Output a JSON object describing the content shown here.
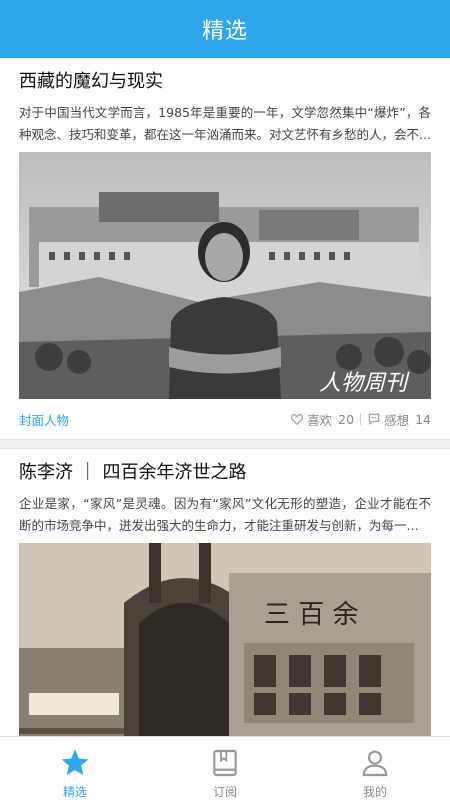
{
  "header": {
    "title": "精选"
  },
  "cards": [
    {
      "title": "西藏的魔幻与现实",
      "summary": "对于中国当代文学而言，1985年是重要的一年，文学忽然集中“爆炸”，各种观念、技巧和变革，都在这一年汹涌而来。对文艺怀有乡愁的人，会不...",
      "image_watermark": "人物周刊",
      "category": "封面人物",
      "likes_label": "喜欢",
      "likes_count": "20",
      "comments_label": "感想",
      "comments_count": "14"
    },
    {
      "title": "陈李济 ｜ 四百余年济世之路",
      "summary": "企业是家，“家风”是灵魂。因为有“家风”文化无形的塑造，企业才能在不断的市场竞争中，迸发出强大的生命力，才能注重研发与创新，为每一...",
      "image_sign": "三 百 余"
    }
  ],
  "tabbar": {
    "items": [
      {
        "label": "精选",
        "icon": "star-icon",
        "active": true
      },
      {
        "label": "订阅",
        "icon": "book-icon",
        "active": false
      },
      {
        "label": "我的",
        "icon": "user-icon",
        "active": false
      }
    ]
  },
  "colors": {
    "accent": "#2ea7ec",
    "muted": "#888888",
    "divider": "#f0f0f0"
  }
}
